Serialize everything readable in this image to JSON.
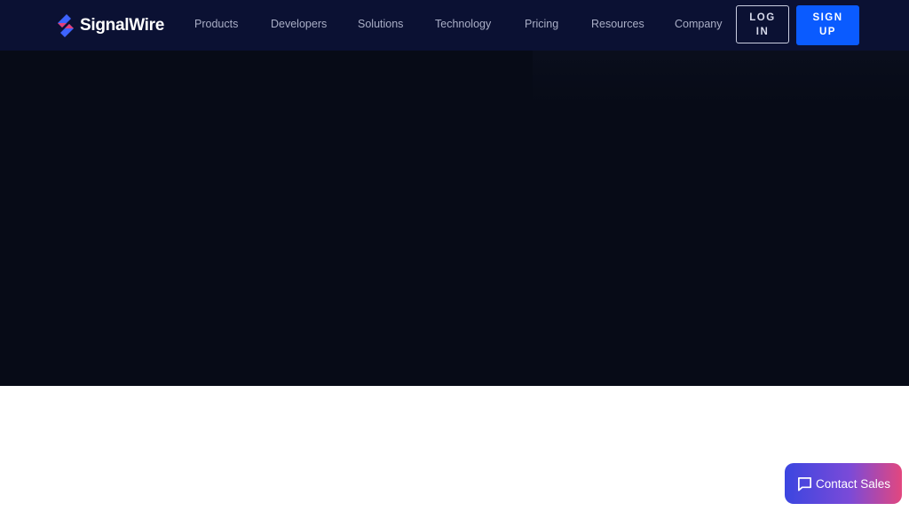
{
  "brand": {
    "name": "SignalWire",
    "logo_icon": "signalwire-logo-icon",
    "colors": {
      "nav_background": "#0b1133",
      "hero_background": "#070b17",
      "primary_button": "#0a5bff",
      "contact_gradient_start": "#3b46e0",
      "contact_gradient_end": "#e2477f"
    }
  },
  "nav": {
    "items": [
      {
        "label": "Products"
      },
      {
        "label": "Developers"
      },
      {
        "label": "Solutions"
      },
      {
        "label": "Technology"
      },
      {
        "label": "Pricing"
      },
      {
        "label": "Resources"
      },
      {
        "label": "Company"
      }
    ],
    "login": {
      "line1": "LOG",
      "line2": "IN"
    },
    "signup": {
      "line1": "SIGN",
      "line2": "UP"
    }
  },
  "contact": {
    "label": "Contact Sales",
    "icon": "chat-bubble-icon"
  }
}
